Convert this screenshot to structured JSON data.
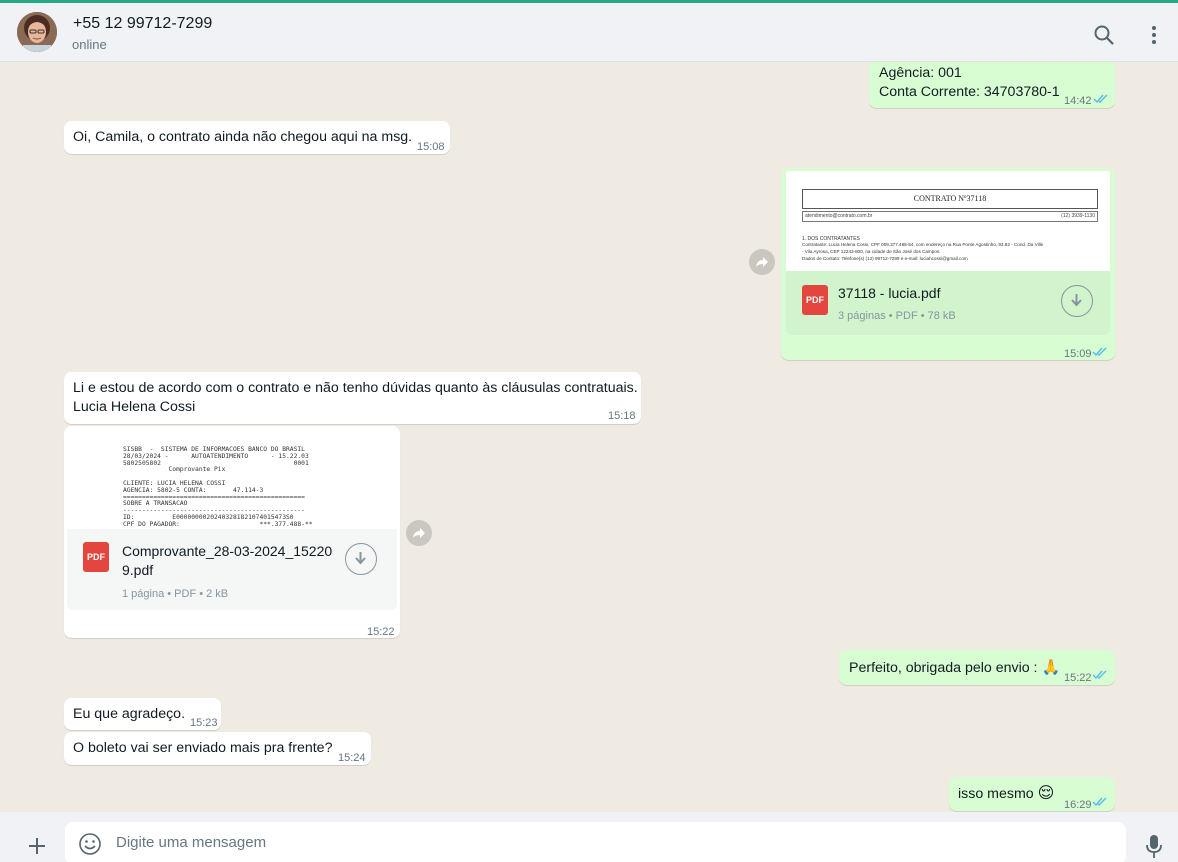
{
  "contact": {
    "name": "+55 12 99712-7299",
    "status": "online"
  },
  "messages": {
    "m0": {
      "line1": "Agência: 001",
      "line2": "Conta Corrente: 34703780-1",
      "time": "14:42"
    },
    "m1": {
      "text": "Oi, Camila, o contrato ainda não chegou aqui na msg.",
      "time": "15:08"
    },
    "m2": {
      "preview_title": "CONTRATO Nº37118",
      "preview_email": "atendimento@contrato.com.br",
      "preview_phone": "(12) 3939-1130",
      "preview_section": "1. DOS CONTRATANTES",
      "preview_line1": "Contratante: Lucia Helena Cossi, CPF 009.377.488-54, com endereço na Rua Ponte Agostinho, 93.82 - Cond. Da Ville",
      "preview_line2": "- Vila Ayrosa, CEP 12243-800, na cidade de São José dos Campos.",
      "preview_line3": "Dados de Contato: Telefone(s) (12) 99712-7299 e e-mail: luciahcossi@gmail.com",
      "file_name": "37118 - lucia.pdf",
      "file_meta": "3 páginas • PDF • 78 kB",
      "time": "15:09"
    },
    "m3": {
      "line1": "Li e estou de acordo com o contrato e não tenho dúvidas quanto às cláusulas contratuais.",
      "line2": "Lucia Helena Cossi",
      "time": "15:18"
    },
    "m4": {
      "preview_lines": [
        "SISBB  -  SISTEMA DE INFORMACOES BANCO DO BRASIL",
        "28/03/2024 -      AUTOATENDIMENTO      - 15.22.03",
        "5802505802                                   0001",
        "            Comprovante Pix",
        "",
        "CLIENTE: LUCIA HELENA COSSI",
        "AGENCIA: 5802-5 CONTA:       47.114-3",
        "================================================",
        "SOBRE A TRANSACAO",
        "------------------------------------------------",
        "ID:          E00000000202403281821074015473S0",
        "CPF DO PAGADOR:                     ***.377.488-**"
      ],
      "file_name_1": "Comprovante_28-03-2024_15220",
      "file_name_2": "9.pdf",
      "file_meta": "1 página • PDF • 2 kB",
      "time": "15:22"
    },
    "m5": {
      "text": "Perfeito, obrigada pelo envio :",
      "emoji": "🙏",
      "time": "15:22"
    },
    "m6": {
      "text": "Eu que agradeço.",
      "time": "15:23"
    },
    "m7": {
      "text": "O boleto vai ser enviado mais pra frente?",
      "time": "15:24"
    },
    "m8": {
      "text": "isso mesmo",
      "emoji": "😌",
      "time": "16:29"
    }
  },
  "composer": {
    "placeholder": "Digite uma mensagem"
  },
  "pdf_label": "PDF",
  "colors": {
    "outgoing": "#d9fdd3",
    "incoming": "#ffffff",
    "read_ticks": "#53bdeb",
    "accent": "#25a884",
    "pdf_icon": "#e2463f"
  },
  "icons": [
    "search-icon",
    "menu-icon",
    "forward-icon",
    "download-icon",
    "pdf-icon",
    "double-check-icon",
    "plus-icon",
    "emoji-icon",
    "mic-icon"
  ]
}
